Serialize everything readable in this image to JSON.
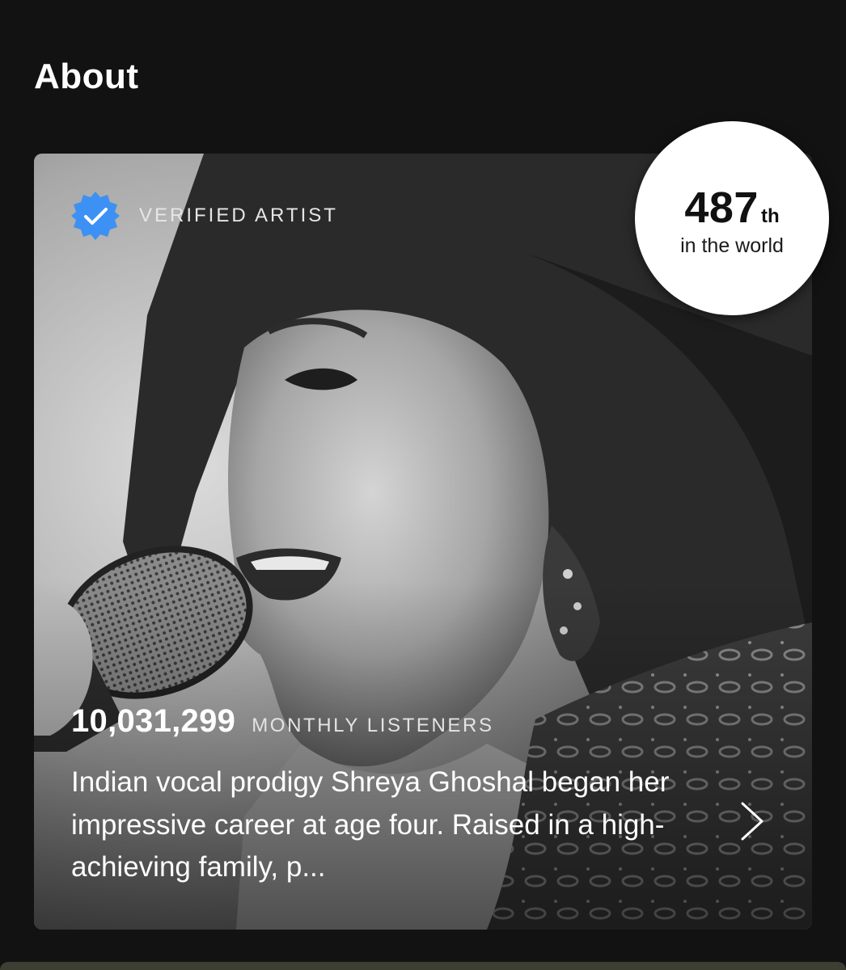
{
  "section": {
    "title": "About"
  },
  "card": {
    "verified_label": "VERIFIED ARTIST",
    "listeners_count": "10,031,299",
    "listeners_label": "MONTHLY LISTENERS",
    "bio": "Indian vocal prodigy Shreya Ghoshal began her impressive career at age four. Raised in a high-achieving family, p..."
  },
  "rank": {
    "number": "487",
    "suffix": "th",
    "caption": "in the world"
  },
  "icons": {
    "verified": "verified-badge-icon",
    "chevron": "chevron-right-icon"
  },
  "colors": {
    "background": "#121212",
    "verified_blue": "#3d91f4",
    "badge_bg": "#ffffff",
    "text_primary": "#ffffff"
  }
}
